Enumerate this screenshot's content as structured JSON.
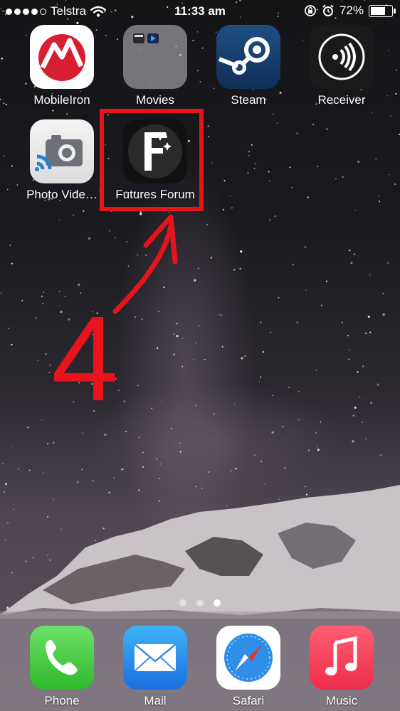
{
  "status_bar": {
    "carrier": "Telstra",
    "time": "11:33 am",
    "battery_percent": "72%",
    "battery_level": 0.72,
    "signal_bars_filled": 4,
    "signal_bars_total": 5
  },
  "home": {
    "apps": [
      {
        "label": "MobileIron",
        "icon": "mobileiron-icon"
      },
      {
        "label": "Movies",
        "icon": "folder-icon"
      },
      {
        "label": "Steam",
        "icon": "steam-icon"
      },
      {
        "label": "Receiver",
        "icon": "receiver-icon"
      },
      {
        "label": "Photo Vide…",
        "icon": "photo-video-icon"
      },
      {
        "label": "Futures Forum",
        "icon": "futures-forum-icon"
      }
    ],
    "page_count": 3,
    "active_page": 3
  },
  "dock": {
    "apps": [
      {
        "label": "Phone",
        "icon": "phone-icon"
      },
      {
        "label": "Mail",
        "icon": "mail-icon"
      },
      {
        "label": "Safari",
        "icon": "safari-icon"
      },
      {
        "label": "Music",
        "icon": "music-icon"
      }
    ]
  },
  "annotation": {
    "step_number": "4",
    "color": "#e6141c"
  }
}
